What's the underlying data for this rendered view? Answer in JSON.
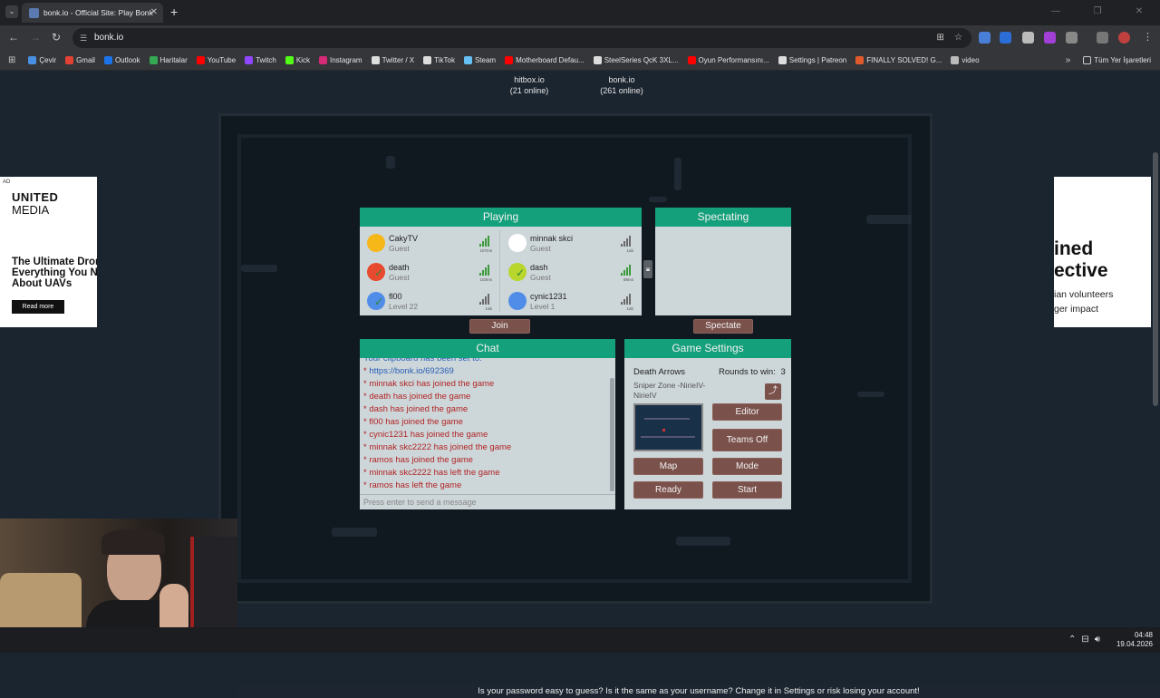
{
  "browser": {
    "tab_title": "bonk.io - Official Site: Play Bonk",
    "url": "bonk.io",
    "bookmarks": [
      {
        "label": "Çevir",
        "color": "#4a90e2"
      },
      {
        "label": "Gmail",
        "color": "#e34133"
      },
      {
        "label": "Outlook",
        "color": "#1a73e8"
      },
      {
        "label": "Haritalar",
        "color": "#34a853"
      },
      {
        "label": "YouTube",
        "color": "#ff0000"
      },
      {
        "label": "Twitch",
        "color": "#9146ff"
      },
      {
        "label": "Kick",
        "color": "#53fc18"
      },
      {
        "label": "Instagram",
        "color": "#d62976"
      },
      {
        "label": "Twitter / X",
        "color": "#dddddd"
      },
      {
        "label": "TikTok",
        "color": "#dddddd"
      },
      {
        "label": "Steam",
        "color": "#66c0f4"
      },
      {
        "label": "Motherboard Defau...",
        "color": "#ff0000"
      },
      {
        "label": "SteelSeries QcK 3XL...",
        "color": "#dddddd"
      },
      {
        "label": "Oyun Performansını...",
        "color": "#ff0000"
      },
      {
        "label": "Settings | Patreon",
        "color": "#dddddd"
      },
      {
        "label": "FINALLY SOLVED! G...",
        "color": "#e05a2b"
      },
      {
        "label": "video",
        "color": "#bbbbbb"
      }
    ],
    "more_bookmarks": "»",
    "all_bookmarks": "Tüm Yer İşaretleri"
  },
  "servers": [
    {
      "name": "hitbox.io",
      "online": "(21 online)"
    },
    {
      "name": "bonk.io",
      "online": "(261 online)"
    }
  ],
  "playing": {
    "title": "Playing",
    "players": [
      {
        "name": "CakyTV",
        "sub": "Guest",
        "color": "#f6b819",
        "ping": "107ms",
        "signal": "green",
        "check": false
      },
      {
        "name": "minnak skci",
        "sub": "Guest",
        "color": "#ffffff",
        "ping": "1ab",
        "signal": "grey",
        "check": false
      },
      {
        "name": "death",
        "sub": "Guest",
        "color": "#e84a2f",
        "ping": "103ms",
        "signal": "green",
        "check": true
      },
      {
        "name": "dash",
        "sub": "Guest",
        "color": "#b8d62b",
        "ping": "88ms",
        "signal": "green",
        "check": true
      },
      {
        "name": "fl00",
        "sub": "Level 22",
        "color": "#4f8de8",
        "ping": "1ab",
        "signal": "grey",
        "check": true
      },
      {
        "name": "cynic1231",
        "sub": "Level 1",
        "color": "#4f8de8",
        "ping": "1ab",
        "signal": "grey",
        "check": false
      }
    ],
    "join_label": "Join"
  },
  "spectating": {
    "title": "Spectating",
    "spectate_label": "Spectate"
  },
  "chat": {
    "title": "Chat",
    "messages": [
      {
        "text": "Your clipboard has been set to:",
        "type": "info"
      },
      {
        "text": "https://bonk.io/692369",
        "type": "link"
      },
      {
        "text": "minnak skci has joined the game",
        "type": "event"
      },
      {
        "text": "death has joined the game",
        "type": "event"
      },
      {
        "text": "dash has joined the game",
        "type": "event"
      },
      {
        "text": "fl00 has joined the game",
        "type": "event"
      },
      {
        "text": "cynic1231 has joined the game",
        "type": "event"
      },
      {
        "text": "minnak skc2222 has joined the game",
        "type": "event"
      },
      {
        "text": "ramos has joined the game",
        "type": "event"
      },
      {
        "text": "minnak skc2222 has left the game",
        "type": "event"
      },
      {
        "text": "ramos has left the game",
        "type": "event"
      }
    ],
    "placeholder": "Press enter to send a message"
  },
  "settings": {
    "title": "Game Settings",
    "mode_name": "Death Arrows",
    "rounds_label": "Rounds to win:",
    "rounds_value": "3",
    "map_name": "Sniper Zone -NirieIV-",
    "map_author": "NirieIV",
    "editor_label": "Editor",
    "teams_label": "Teams Off",
    "map_label": "Map",
    "mode_label": "Mode",
    "ready_label": "Ready",
    "start_label": "Start"
  },
  "ads": {
    "ad_tag": "AD",
    "left_brand_1": "UNITED",
    "left_brand_2": "MEDIA",
    "left_headline": "The Ultimate Drone Everything You Need About UAVs",
    "left_cta": "Read more",
    "right_line_1": "ined",
    "right_line_2": "ective",
    "right_line_3": "ian volunteers",
    "right_line_4": "ger impact"
  },
  "bottom_message": "Is your password easy to guess? Is it the same as your username? Change it in Settings or risk losing your account!",
  "taskbar": {
    "time": "04:48",
    "date": "19.04.2026"
  }
}
